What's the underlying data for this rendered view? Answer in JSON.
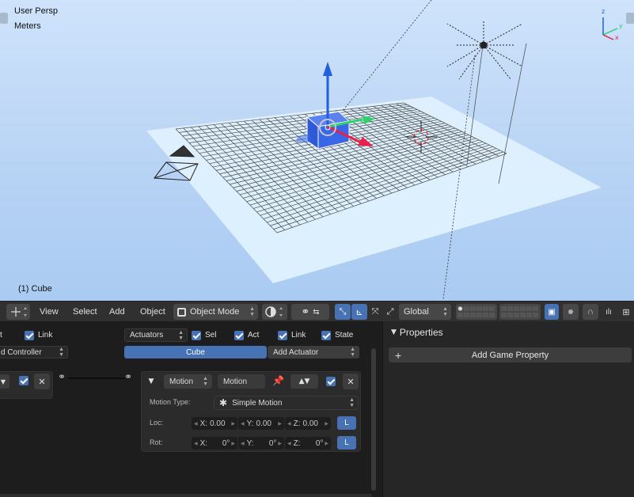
{
  "viewport": {
    "view_name": "User Persp",
    "units": "Meters",
    "object_label": "(1) Cube"
  },
  "header": {
    "menus": [
      "View",
      "Select",
      "Add",
      "Object"
    ],
    "mode": "Object Mode",
    "orientation": "Global"
  },
  "logic": {
    "sensors_partial_label": "t",
    "sensor_link": "Link",
    "controller_partial": "d Controller",
    "actuators_filter": "Actuators",
    "act_checks": [
      "Sel",
      "Act",
      "Link",
      "State"
    ],
    "object_name": "Cube",
    "add_actuator": "Add Actuator",
    "actuator": {
      "type": "Motion",
      "name": "Motion",
      "motion_type_label": "Motion Type:",
      "motion_type": "Simple Motion",
      "loc_label": "Loc:",
      "rot_label": "Rot:",
      "loc": [
        {
          "axis": "X:",
          "value": "0.00"
        },
        {
          "axis": "Y:",
          "value": "0.00"
        },
        {
          "axis": "Z:",
          "value": "0.00"
        }
      ],
      "rot": [
        {
          "axis": "X:",
          "value": "0°"
        },
        {
          "axis": "Y:",
          "value": "0°"
        },
        {
          "axis": "Z:",
          "value": "0°"
        }
      ],
      "local_label": "L"
    }
  },
  "properties": {
    "title": "Properties",
    "add_button": "Add Game Property",
    "plus": "+"
  },
  "colors": {
    "accent": "#4772b3",
    "viewport_bg": "#b6d2f4",
    "axis_z": "#1f5fe0",
    "axis_x": "#e8204a",
    "axis_y": "#2ed16a"
  }
}
